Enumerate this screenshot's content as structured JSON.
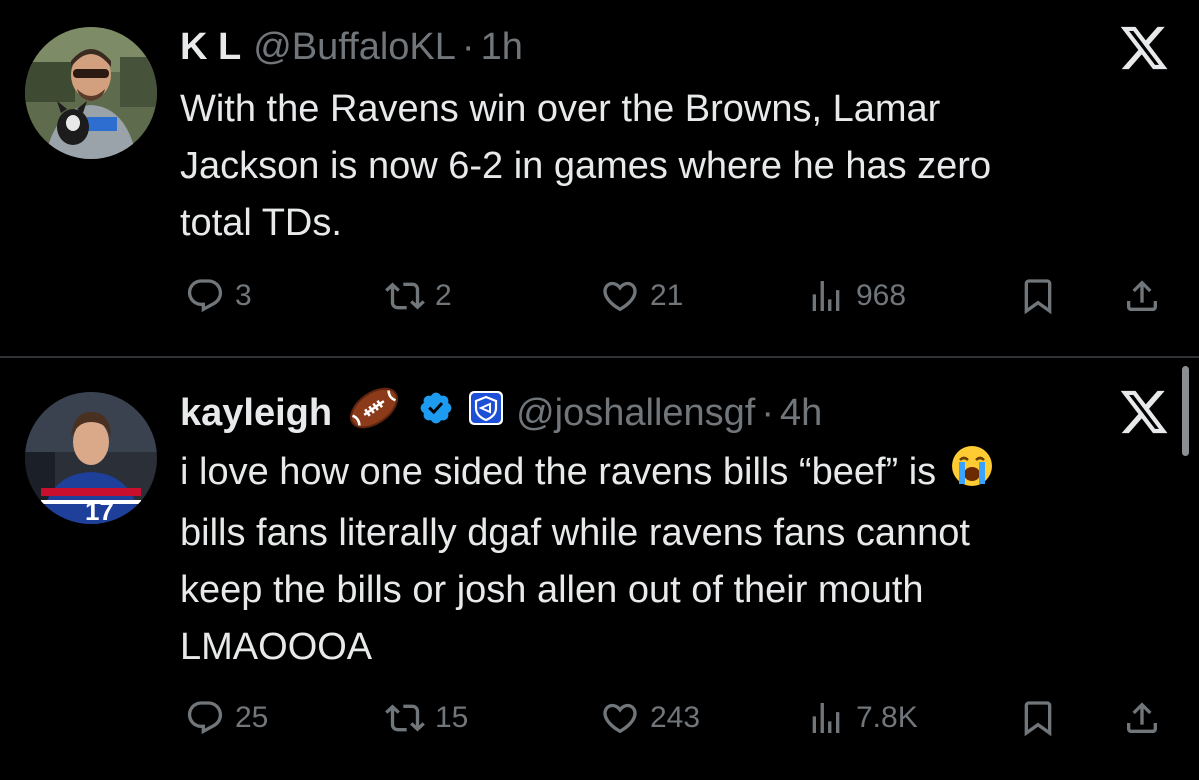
{
  "tweets": [
    {
      "display_name": "K L",
      "handle": "@BuffaloKL",
      "separator": "·",
      "time": "1h",
      "avatar_icon": "profile-photo-man-with-dog",
      "text_lines": [
        "With the Ravens win over the Browns, Lamar",
        "Jackson is now 6-2 in games where he has zero",
        "total TDs."
      ],
      "replies": "3",
      "reposts": "2",
      "likes": "21",
      "views": "968"
    },
    {
      "display_name": "kayleigh",
      "handle": "@joshallensgf",
      "separator": "·",
      "time": "4h",
      "avatar_icon": "profile-photo-football-player",
      "name_emoji": "football-emoji",
      "badges": [
        "verified-badge-icon",
        "shield-affiliate-badge-icon"
      ],
      "text_lines": [
        "i love how one sided the ravens bills “beef” is",
        "bills fans literally dgaf while ravens fans cannot",
        "keep the bills or josh allen out of their mouth",
        "LMAOOOA"
      ],
      "line1_emoji": "loudly-crying-face-emoji",
      "replies": "25",
      "reposts": "15",
      "likes": "243",
      "views": "7.8K"
    }
  ],
  "colors": {
    "background": "#000000",
    "text": "#e7e9ea",
    "muted": "#71767b",
    "verified": "#1d9bf0",
    "divider": "#2f3336"
  }
}
